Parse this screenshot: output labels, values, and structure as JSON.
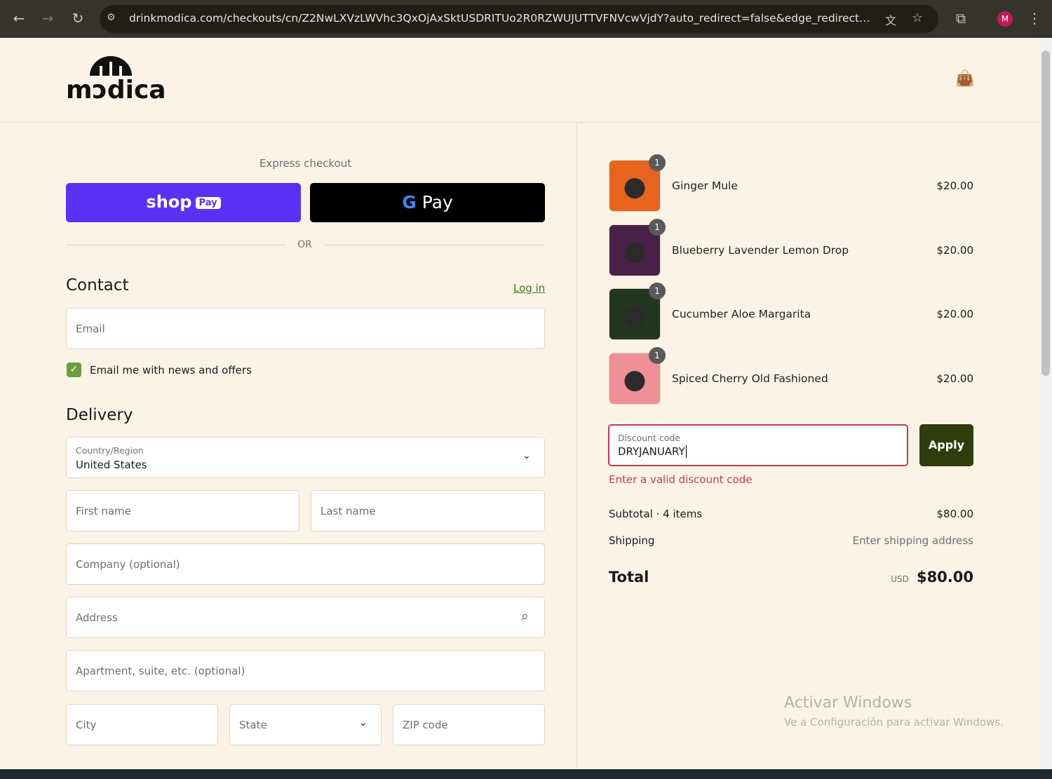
{
  "browser": {
    "url": "drinkmodica.com/checkouts/cn/Z2NwLXVzLWVhc3QxOjAxSktUSDRITUo2R0RZWUJUTTVFNVcwVjdY?auto_redirect=false&edge_redirect=true&lo...",
    "profile_initial": "M"
  },
  "brand": {
    "logo": "modica."
  },
  "express": {
    "label": "Express checkout",
    "shop_pay": "shop",
    "shop_pay_badge": "Pay",
    "gpay": "Pay",
    "or": "OR"
  },
  "contact": {
    "title": "Contact",
    "login": "Log in",
    "email_placeholder": "Email",
    "newsletter": "Email me with news and offers"
  },
  "delivery": {
    "title": "Delivery",
    "country_label": "Country/Region",
    "country": "United States",
    "first_name": "First name",
    "last_name": "Last name",
    "company": "Company (optional)",
    "address": "Address",
    "apartment": "Apartment, suite, etc. (optional)",
    "city": "City",
    "state": "State",
    "zip": "ZIP code"
  },
  "cart": {
    "items": [
      {
        "name": "Ginger Mule",
        "price": "$20.00",
        "qty": "1",
        "color": "#e8641e"
      },
      {
        "name": "Blueberry Lavender Lemon Drop",
        "price": "$20.00",
        "qty": "1",
        "color": "#4a2146"
      },
      {
        "name": "Cucumber Aloe Margarita",
        "price": "$20.00",
        "qty": "1",
        "color": "#23361f"
      },
      {
        "name": "Spiced Cherry Old Fashioned",
        "price": "$20.00",
        "qty": "1",
        "color": "#ef8f96"
      }
    ]
  },
  "discount": {
    "label": "Discount code",
    "value": "DRYJANUARY",
    "apply": "Apply",
    "error": "Enter a valid discount code"
  },
  "summary": {
    "subtotal_label": "Subtotal · 4 items",
    "subtotal": "$80.00",
    "shipping_label": "Shipping",
    "shipping": "Enter shipping address",
    "total_label": "Total",
    "currency": "USD",
    "total": "$80.00"
  },
  "watermark": {
    "title": "Activar Windows",
    "subtitle": "Ve a Configuración para activar Windows."
  }
}
